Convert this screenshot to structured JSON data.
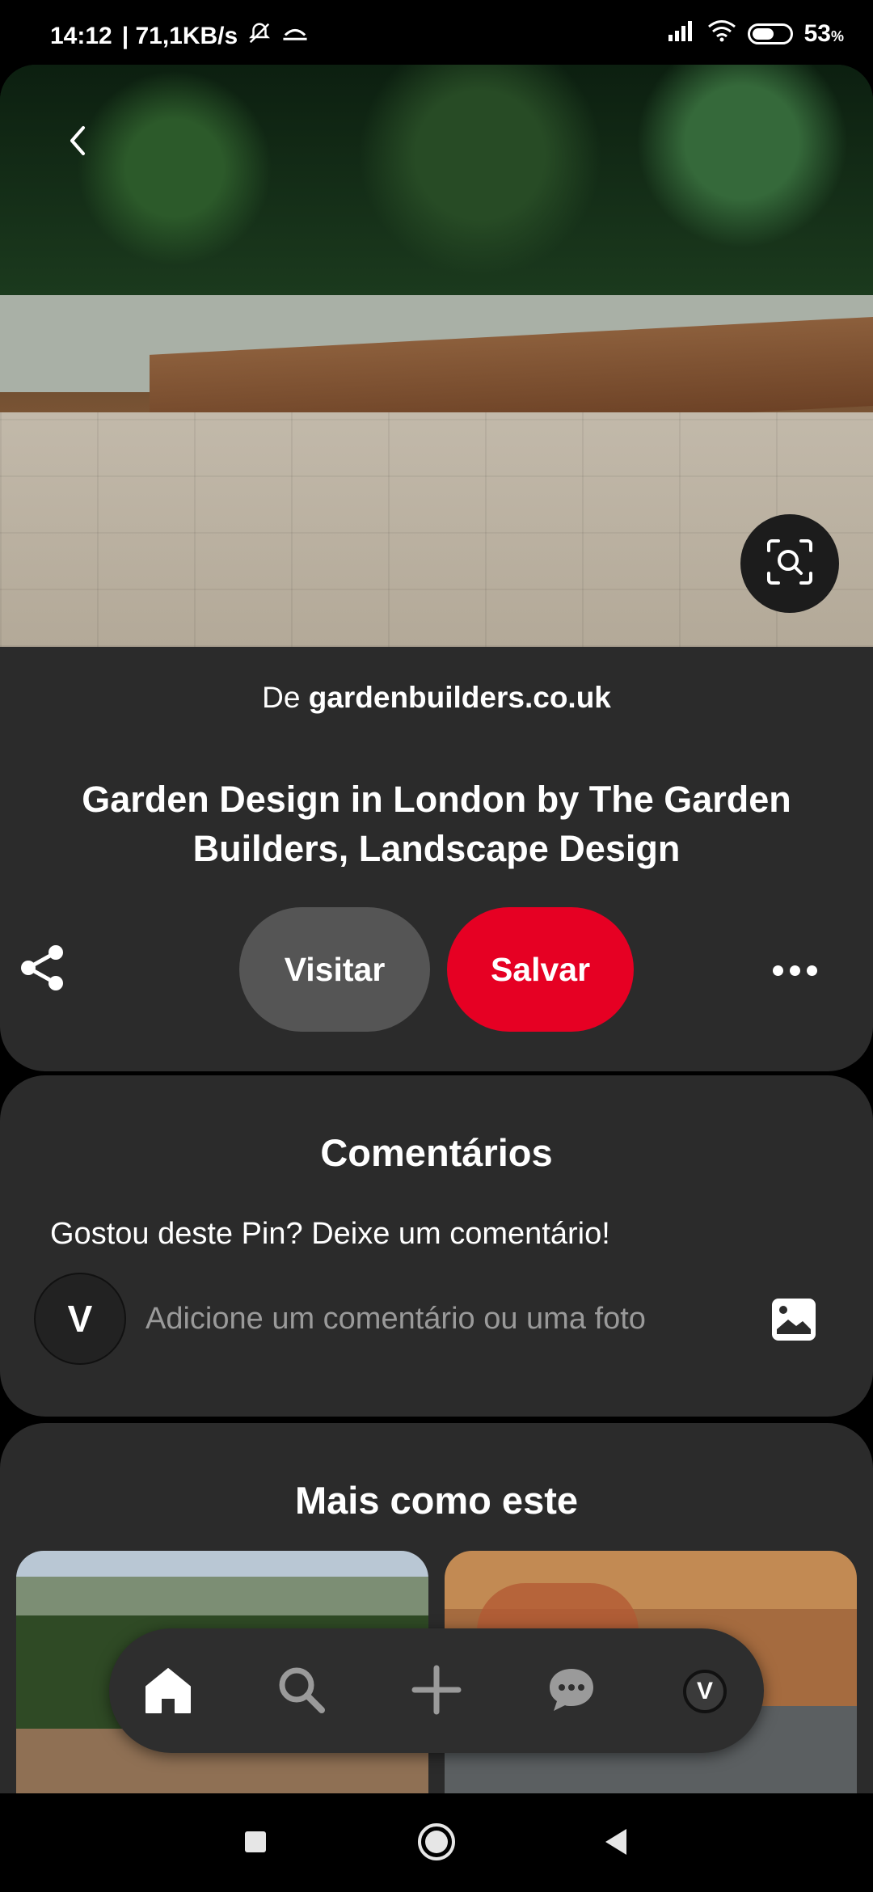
{
  "status_bar": {
    "time": "14:12",
    "network_speed": "| 71,1KB/s",
    "battery": "53",
    "battery_unit": "%",
    "icons": [
      "notifications-off-icon",
      "cast-icon",
      "signal-icon",
      "wifi-icon",
      "battery-icon"
    ]
  },
  "hero": {
    "back_icon": "chevron-left-icon",
    "lens_icon": "visual-search-icon"
  },
  "pin": {
    "source_prefix": "De",
    "source_domain": "gardenbuilders.co.uk",
    "title": "Garden Design in London by The Garden Builders, Landscape Design",
    "share_icon": "share-icon",
    "visit_label": "Visitar",
    "save_label": "Salvar",
    "more_icon": "more-dots-icon"
  },
  "comments": {
    "title": "Comentários",
    "prompt": "Gostou deste Pin? Deixe um comentário!",
    "avatar_letter": "V",
    "input_placeholder": "Adicione um comentário ou uma foto",
    "photo_icon": "image-icon"
  },
  "more_like_this": {
    "title": "Mais como este"
  },
  "bottom_nav": {
    "items": [
      "home-icon",
      "search-icon",
      "plus-icon",
      "chat-icon",
      "profile-avatar"
    ],
    "avatar_letter": "V"
  },
  "system_nav": {
    "items": [
      "recents-icon",
      "home-icon",
      "back-icon"
    ]
  },
  "colors": {
    "background": "#000000",
    "card": "#2b2b2b",
    "save_button": "#e60023",
    "visit_button": "#555555"
  }
}
